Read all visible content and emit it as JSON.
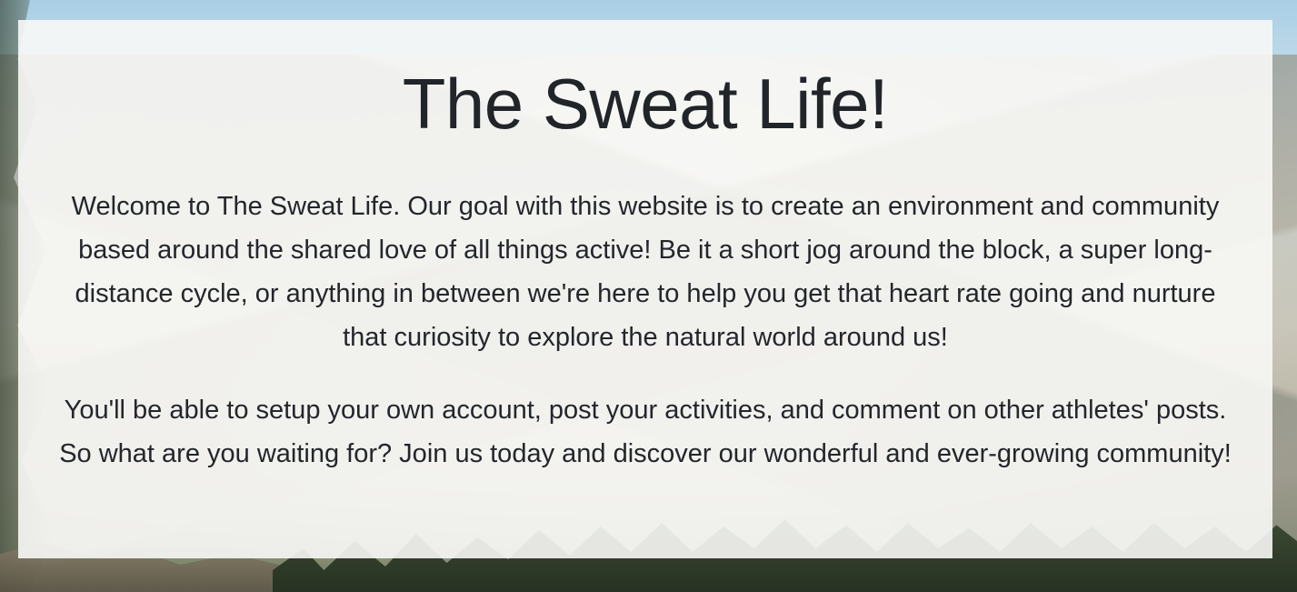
{
  "hero": {
    "title": "The Sweat Life!",
    "paragraphs": [
      "Welcome to The Sweat Life. Our goal with this website is to create an environment and community based around the shared love of all things active! Be it a short jog around the block, a super long-distance cycle, or anything in between we're here to help you get that heart rate going and nurture that curiosity to explore the natural world around us!",
      "You'll be able to setup your own account, post your activities, and comment on other athletes' posts. So what are you waiting for? Join us today and discover our wonderful and ever-growing community!"
    ]
  },
  "background": {
    "scene": "mountain-lake-landscape-photo"
  },
  "colors": {
    "card_background": "#f8f8f6",
    "text": "#212529"
  }
}
